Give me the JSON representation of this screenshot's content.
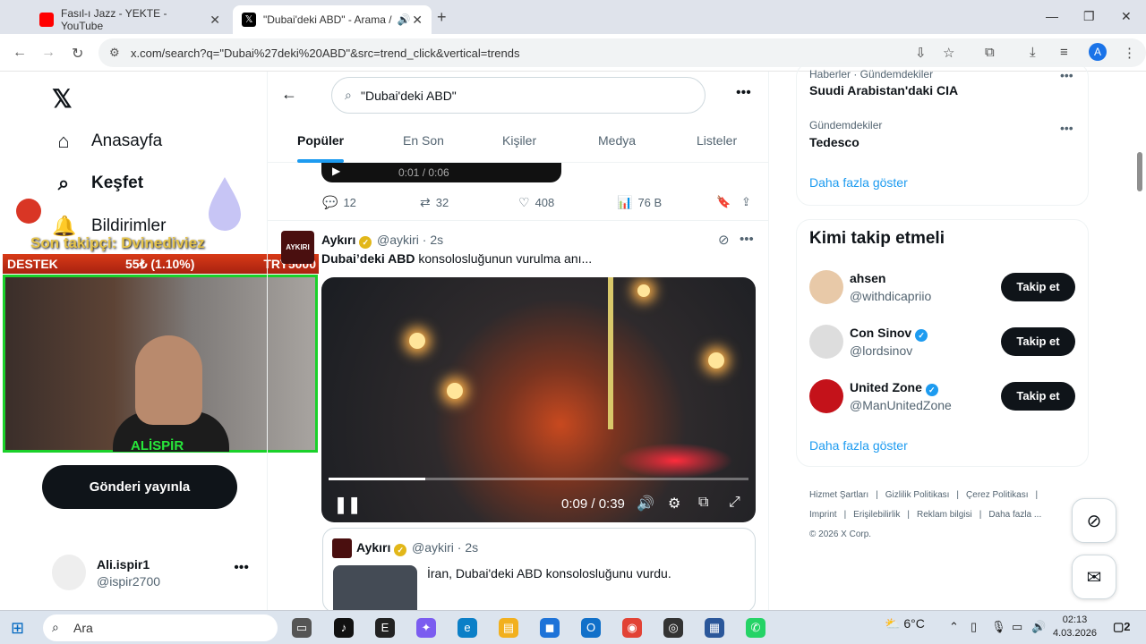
{
  "browser": {
    "tabs": [
      {
        "title": "Fasıl-ı Jazz - YEKTE - YouTube"
      },
      {
        "title": "\"Dubai'deki ABD\" - Arama /"
      }
    ],
    "url": "x.com/search?q=\"Dubai%27deki%20ABD\"&src=trend_click&vertical=trends",
    "profile_initial": "A"
  },
  "sidebar": {
    "items": [
      {
        "label": "Anasayfa"
      },
      {
        "label": "Keşfet"
      },
      {
        "label": "Bildirimler"
      }
    ],
    "post_button": "Gönderi yayınla",
    "user": {
      "name": "Ali.ispir1",
      "handle": "@ispir2700"
    }
  },
  "stream_overlay": {
    "last_follower": "Son takipçi: Dvinediviez",
    "bar_left": "DESTEK",
    "bar_middle": "55₺ (1.10%)",
    "bar_right": "TRY5000",
    "cam_name": "ALİSPİR"
  },
  "search": {
    "query": "\"Dubai'deki ABD\"",
    "tabs": [
      "Popüler",
      "En Son",
      "Kişiler",
      "Medya",
      "Listeler"
    ],
    "active_tab": "Popüler"
  },
  "prev_tweet": {
    "video_time": "0:01 / 0:06",
    "replies": "12",
    "reposts": "32",
    "likes": "408",
    "views": "76 B"
  },
  "tweet": {
    "avatar_text": "AYKIRI",
    "name": "Aykırı",
    "handle_time": "@aykiri · 2s",
    "text_bold": "Dubai’deki ABD",
    "text_rest": " konsolosluğunun vurulma anı...",
    "video_time": "0:09 / 0:39",
    "progress": 0.23
  },
  "quoted": {
    "name": "Aykırı",
    "handle_time": "@aykiri · 2s",
    "text": "İran, Dubai'deki ABD konsolosluğunu vurdu."
  },
  "trends": [
    {
      "category": "Haberler · Gündemdekiler",
      "name": "Suudi Arabistan'daki CIA"
    },
    {
      "category": "Gündemdekiler",
      "name": "Tedesco"
    }
  ],
  "trends_show_more": "Daha fazla göster",
  "who_to_follow": {
    "title": "Kimi takip etmeli",
    "follow_label": "Takip et",
    "show_more": "Daha fazla göster",
    "users": [
      {
        "name": "ahsen",
        "handle": "@withdicapriio",
        "verified": false
      },
      {
        "name": "Con Sinov",
        "handle": "@lordsinov",
        "verified": true
      },
      {
        "name": "United Zone",
        "handle": "@ManUnitedZone",
        "verified": true
      }
    ]
  },
  "footer": {
    "links": [
      "Hizmet Şartları",
      "|",
      "Gizlilik Politikası",
      "|",
      "Çerez Politikası",
      "|",
      "Imprint",
      "|",
      "Erişilebilirlik",
      "|",
      "Reklam bilgisi",
      "|",
      "Daha fazla ..."
    ],
    "copyright": "© 2026 X Corp."
  },
  "taskbar": {
    "search_placeholder": "Ara",
    "temperature": "6°C",
    "time": "02:13",
    "date": "4.03.2026",
    "notifications": "2"
  },
  "colors": {
    "accent": "#1d9bf0",
    "stream_green": "#1ad12a",
    "bar_red": "#d83a17"
  }
}
